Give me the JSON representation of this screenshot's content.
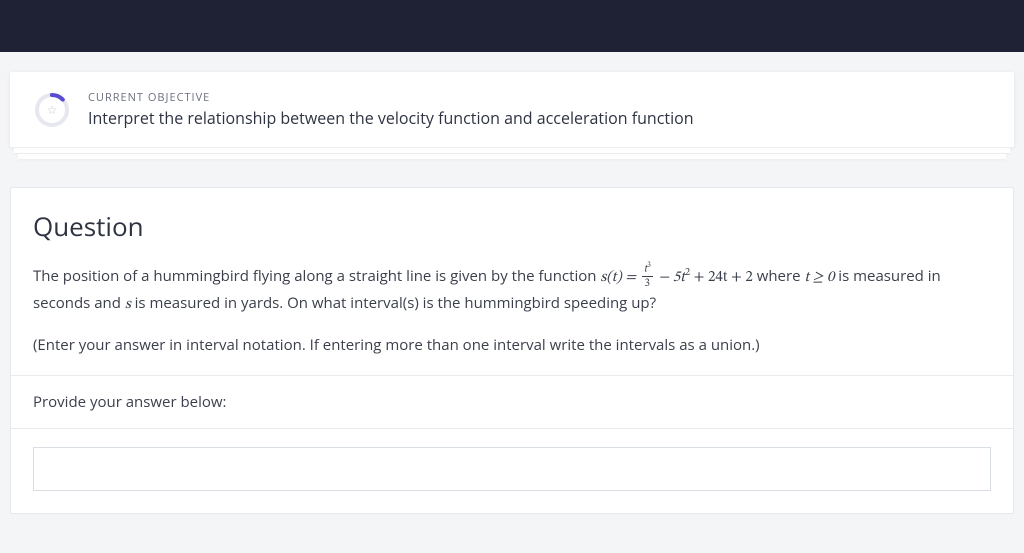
{
  "objective": {
    "label": "CURRENT OBJECTIVE",
    "text": "Interpret the relationship between the velocity function and acceleration function"
  },
  "question": {
    "heading": "Question",
    "body_pre": "The position of a hummingbird flying along a straight line is given by the function ",
    "func_lhs": "s(t) = ",
    "frac_num_var": "t",
    "frac_num_exp": "3",
    "frac_den": "3",
    "term2": " − 5t",
    "term2_exp": "2",
    "term3": " + 24t + 2",
    "body_mid": " where ",
    "cond": "t ≥ 0",
    "body_post": " is measured in seconds and ",
    "svar": "s",
    "body_end": " is measured in yards. On what interval(s) is the hummingbird speeding up?",
    "hint": "(Enter your answer in interval notation. If entering more than one interval write the intervals as a union.)",
    "answer_label": "Provide your answer below:",
    "answer_value": ""
  }
}
